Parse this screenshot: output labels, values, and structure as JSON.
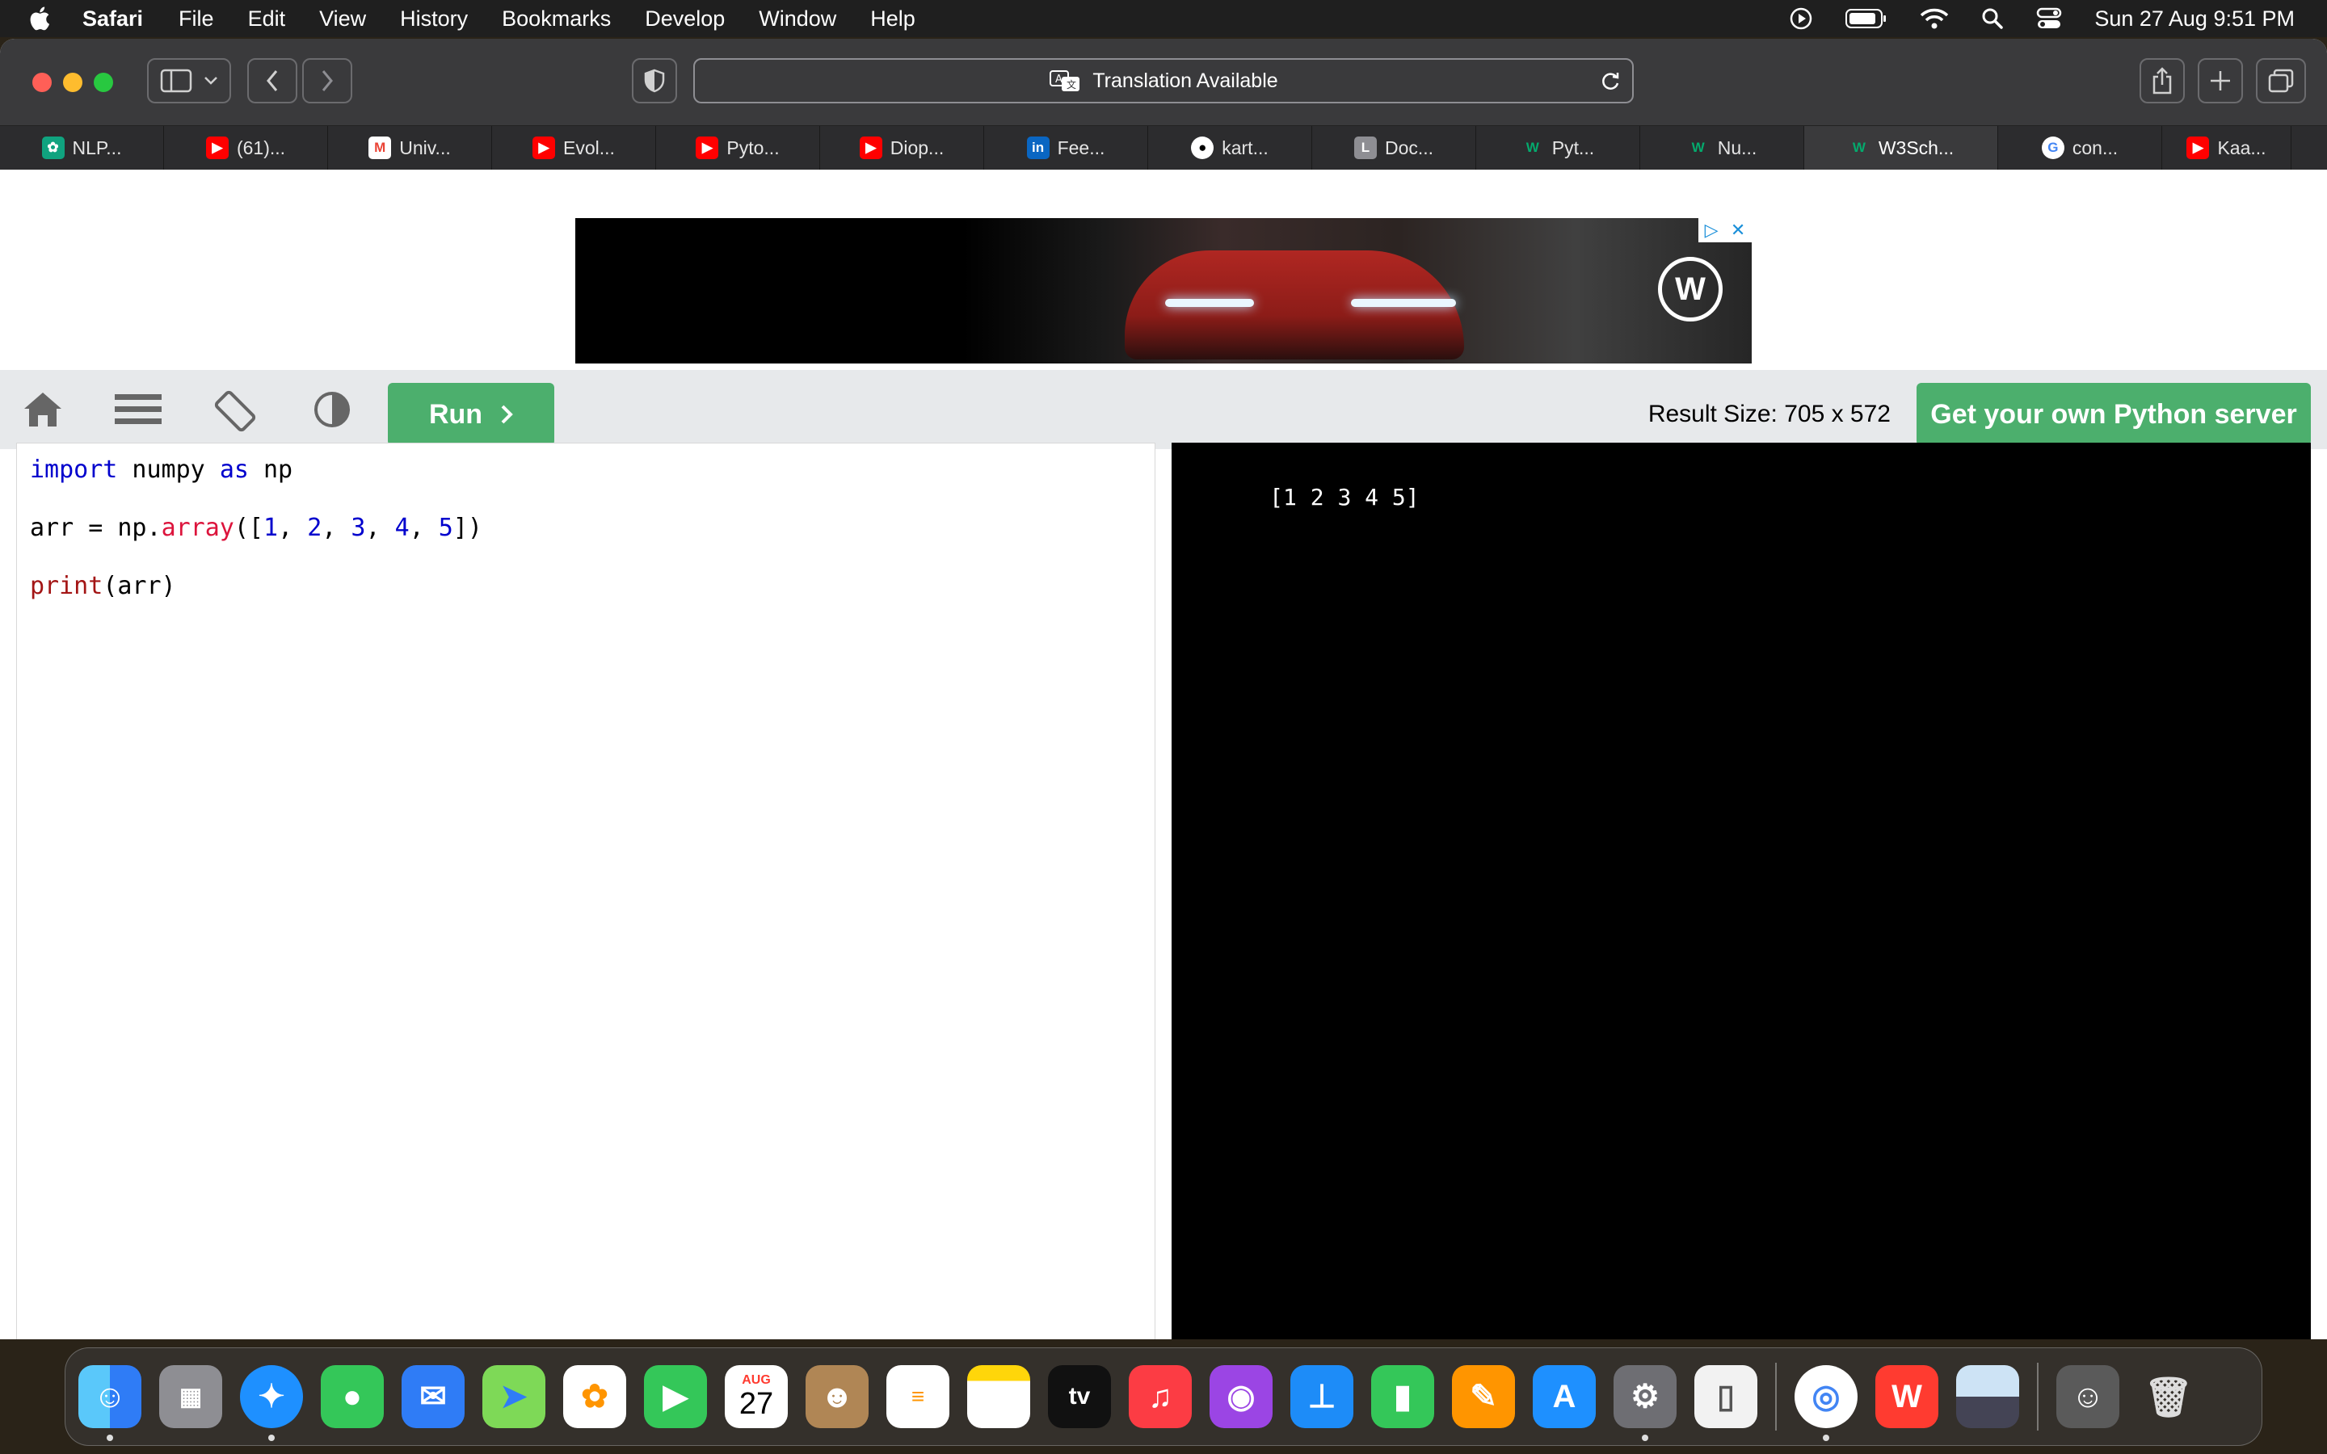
{
  "menubar": {
    "app_name": "Safari",
    "menus": [
      "File",
      "Edit",
      "View",
      "History",
      "Bookmarks",
      "Develop",
      "Window",
      "Help"
    ],
    "clock": "Sun 27 Aug  9:51 PM"
  },
  "address_bar": {
    "text": "Translation Available"
  },
  "tabs": [
    {
      "label": "NLP...",
      "icon": "chatgpt-icon",
      "color": "#10a37f"
    },
    {
      "label": "(61)...",
      "icon": "youtube-icon",
      "color": "#ff0000"
    },
    {
      "label": "Univ...",
      "icon": "gmail-icon",
      "color": "#ea4335"
    },
    {
      "label": "Evol...",
      "icon": "youtube-icon",
      "color": "#ff0000"
    },
    {
      "label": "Pyto...",
      "icon": "youtube-icon",
      "color": "#ff0000"
    },
    {
      "label": "Diop...",
      "icon": "youtube-icon",
      "color": "#ff0000"
    },
    {
      "label": "Fee...",
      "icon": "linkedin-icon",
      "color": "#0a66c2"
    },
    {
      "label": "kart...",
      "icon": "github-icon",
      "color": "#ffffff"
    },
    {
      "label": "Doc...",
      "icon": "letter-l-icon",
      "color": "#8e8e93"
    },
    {
      "label": "Pyt...",
      "icon": "w3schools-icon",
      "color": "#04aa6d"
    },
    {
      "label": "Nu...",
      "icon": "w3schools-icon",
      "color": "#04aa6d"
    },
    {
      "label": "W3Sch...",
      "icon": "w3schools-icon",
      "color": "#04aa6d"
    },
    {
      "label": "con...",
      "icon": "google-icon",
      "color": "#4285f4"
    },
    {
      "label": "Kaa...",
      "icon": "youtube-icon",
      "color": "#ff0000"
    }
  ],
  "toolbar": {
    "run_label": "Run",
    "result_size": "Result Size: 705 x 572",
    "own_server_label": "Get your own Python server"
  },
  "editor": {
    "lines": [
      "import numpy as np",
      "arr = np.array([1, 2, 3, 4, 5])",
      "print(arr)"
    ]
  },
  "result": {
    "output": "[1 2 3 4 5]"
  },
  "dock": {
    "calendar_month": "AUG",
    "calendar_day": "27",
    "tv_label": "tv"
  },
  "colors": {
    "accent_green": "#4caf6d",
    "menubar_bg": "#1f1f1f",
    "result_bg": "#000000"
  }
}
